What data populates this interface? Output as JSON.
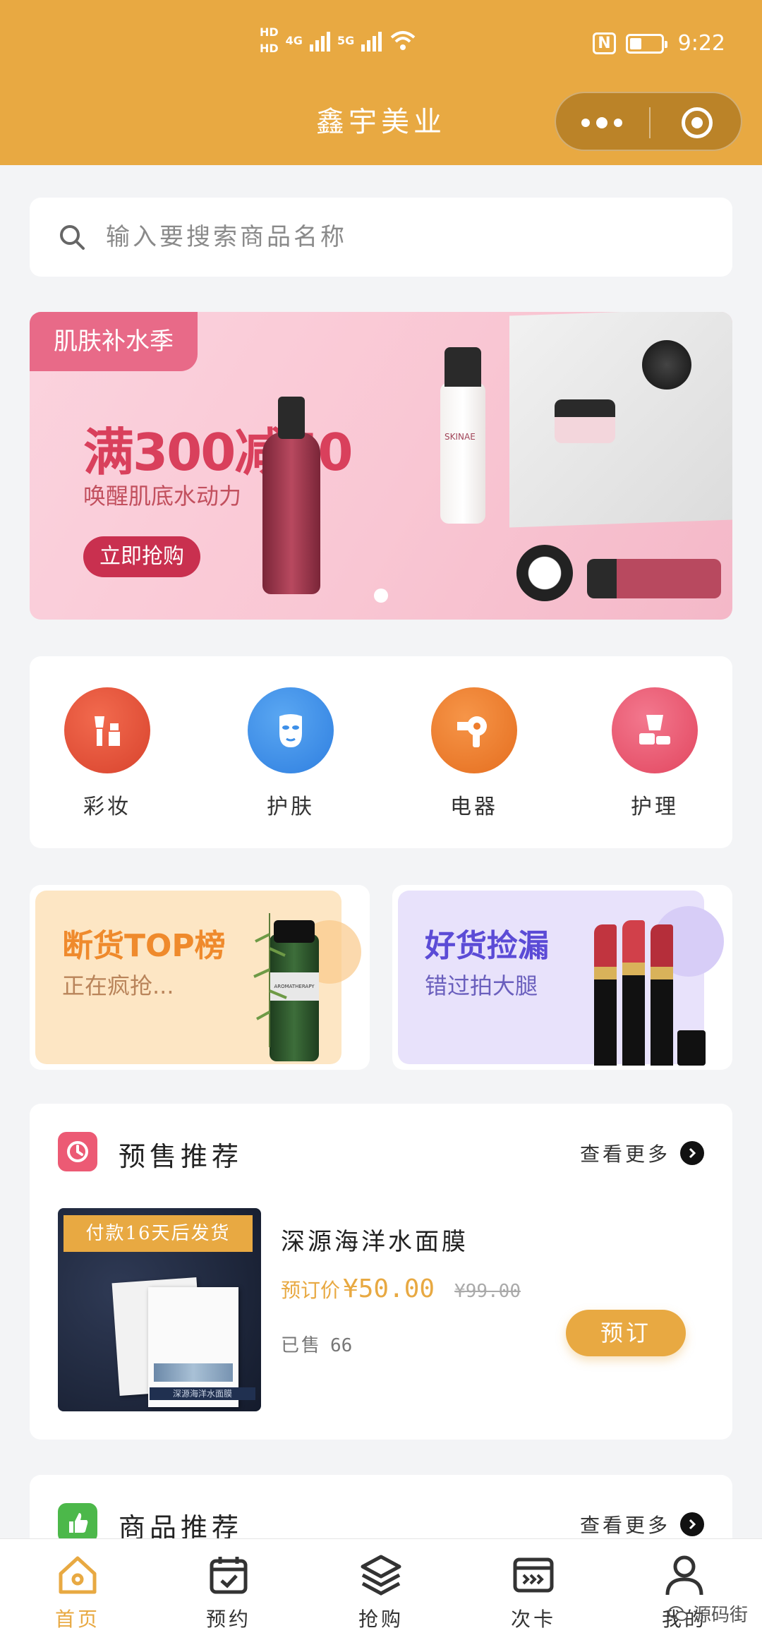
{
  "status_bar": {
    "hd1": "HD",
    "hd2": "HD",
    "net1": "4G",
    "net2": "5G",
    "nfc": "N",
    "time": "9:22"
  },
  "header": {
    "title": "鑫宇美业"
  },
  "search": {
    "placeholder": "输入要搜索商品名称"
  },
  "banner": {
    "tag": "肌肤补水季",
    "headline": "满300减50",
    "subline": "唤醒肌底水动力",
    "cta": "立即抢购",
    "product_text": "SKINAE"
  },
  "categories": [
    {
      "label": "彩妆",
      "icon": "makeup-brush-icon",
      "color": "#e8533a"
    },
    {
      "label": "护肤",
      "icon": "face-mask-icon",
      "color": "#3d8fe8"
    },
    {
      "label": "电器",
      "icon": "hair-dryer-icon",
      "color": "#ee7d2c"
    },
    {
      "label": "护理",
      "icon": "skincare-bottle-icon",
      "color": "#ec5a74"
    }
  ],
  "promos": [
    {
      "title": "断货TOP榜",
      "subtitle": "正在疯抢...",
      "bottle_text": "AROMATHERAPY",
      "bg": "#fde6c4",
      "title_color": "#ef8a2c",
      "sub_color": "#b9845a"
    },
    {
      "title": "好货捡漏",
      "subtitle": "错过拍大腿",
      "bg": "#e8e2fb",
      "title_color": "#5b4bd6",
      "sub_color": "#6a5fbd"
    }
  ],
  "presale": {
    "title": "预售推荐",
    "more": "查看更多",
    "product": {
      "ribbon": "付款16天后发货",
      "name": "深源海洋水面膜",
      "price_label": "预订价",
      "price": "¥50.00",
      "old_price": "¥99.00",
      "sold_label": "已售",
      "sold": "66",
      "button": "预订",
      "box_caption": "深源海洋水面膜"
    }
  },
  "recommend": {
    "title": "商品推荐",
    "more": "查看更多"
  },
  "tabbar": [
    {
      "label": "首页",
      "icon": "home-icon",
      "active": true
    },
    {
      "label": "预约",
      "icon": "calendar-check-icon",
      "active": false
    },
    {
      "label": "抢购",
      "icon": "layers-icon",
      "active": false
    },
    {
      "label": "次卡",
      "icon": "card-icon",
      "active": false
    },
    {
      "label": "我的",
      "icon": "user-icon",
      "active": false
    }
  ],
  "watermark": "源码街",
  "colors": {
    "brand": "#e8a942",
    "banner_red": "#d9405c"
  }
}
